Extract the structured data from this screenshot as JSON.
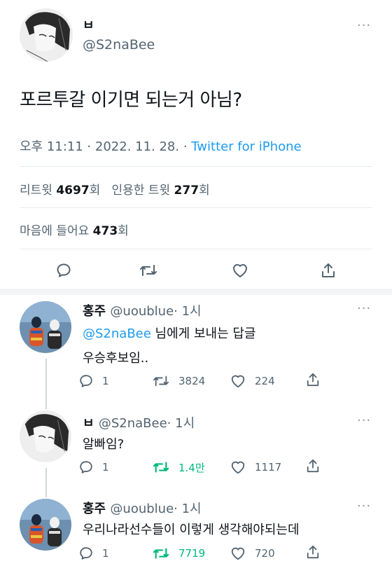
{
  "tweet": {
    "display_name": "ㅂ",
    "handle": "@S2naBee",
    "text": "포르투갈 이기면 되는거 아님?",
    "time": "오후 11:11 · 2022. 11. 28. · ",
    "source": "Twitter for iPhone",
    "retweets_label": "리트윗",
    "retweets_count": "4697",
    "retweets_unit": "회",
    "quotes_label": "인용한 트윗",
    "quotes_count": "277",
    "quotes_unit": "회",
    "likes_label": "마음에 들어요",
    "likes_count": "473",
    "likes_unit": "회",
    "more": "···"
  },
  "replies": [
    {
      "display_name": "홍주",
      "handle": "@uoublue",
      "time": "· 1시",
      "reply_to_mention": "@S2naBee",
      "reply_to_suffix": " 님에게 보내는 답글",
      "text": "우승후보임..",
      "replies": "1",
      "retweets": "3824",
      "likes": "224",
      "more": "···"
    },
    {
      "display_name": "ㅂ",
      "handle": "@S2naBee",
      "time": "· 1시",
      "text": "알빠임?",
      "replies": "1",
      "retweets": "1.4만",
      "likes": "1117",
      "more": "···"
    },
    {
      "display_name": "홍주",
      "handle": "@uoublue",
      "time": "· 1시",
      "text": "우리나라선수들이 이렇게 생각해야되는데",
      "replies": "1",
      "retweets": "7719",
      "likes": "720",
      "more": "···"
    }
  ],
  "colors": {
    "accent": "#1d9bf0",
    "retweet_active": "#00ba7c",
    "secondary_text": "#536471"
  }
}
